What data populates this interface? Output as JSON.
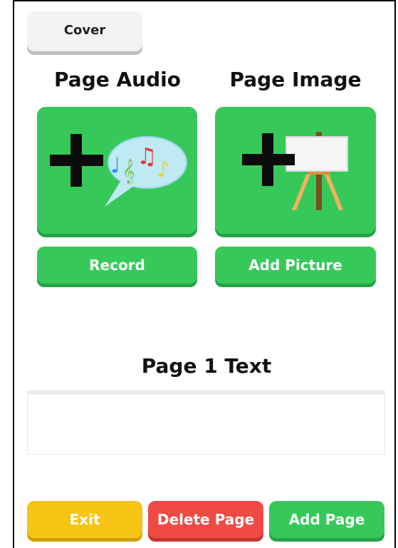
{
  "header": {
    "cover_label": "Cover"
  },
  "audio": {
    "title": "Page Audio",
    "button_label": "Record"
  },
  "image": {
    "title": "Page Image",
    "button_label": "Add Picture"
  },
  "text_section": {
    "title": "Page 1 Text",
    "value": ""
  },
  "footer": {
    "exit_label": "Exit",
    "delete_label": "Delete Page",
    "add_label": "Add Page"
  },
  "colors": {
    "green": "#36c95a",
    "yellow": "#f5c414",
    "red": "#ef4a44",
    "cover_gray": "#f3f3f3"
  },
  "icons": [
    "plus-icon",
    "music-bubble-icon",
    "easel-icon"
  ]
}
